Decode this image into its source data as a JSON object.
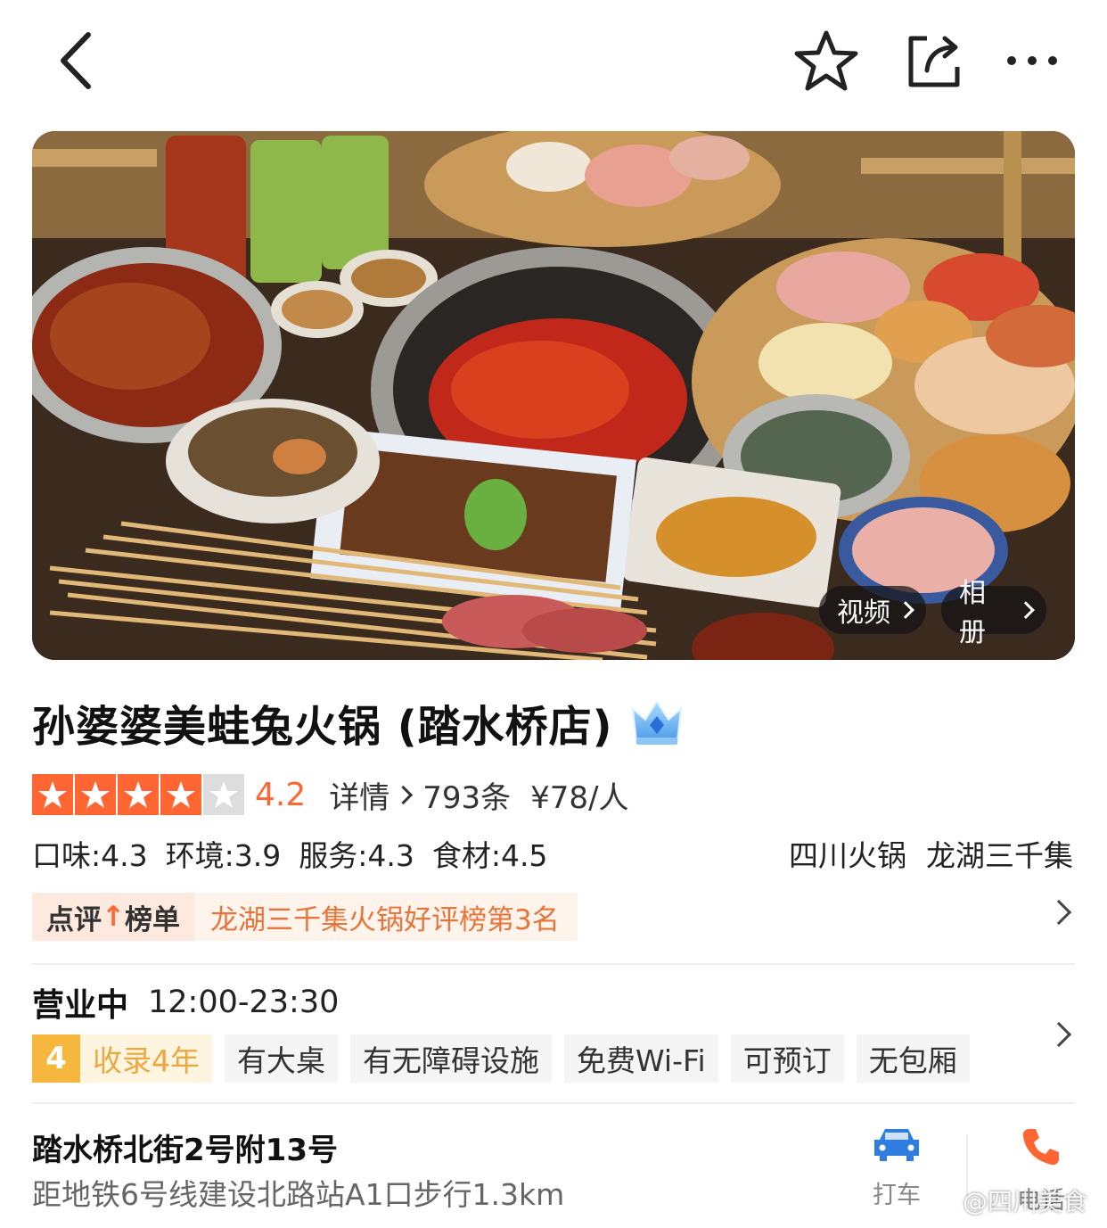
{
  "topbar": {
    "back_icon": "chevron-left-icon",
    "favorite_icon": "star-outline-icon",
    "share_icon": "share-icon",
    "more_icon": "more-dots-icon"
  },
  "hero": {
    "video_label": "视频",
    "album_label": "相册"
  },
  "shop": {
    "title": "孙婆婆美蛙兔火锅 (踏水桥店)",
    "title_badge_icon": "crown-icon"
  },
  "rating": {
    "stars": 4,
    "score": "4.2",
    "detail_label": "详情",
    "review_count": "793条",
    "price": "¥78/人"
  },
  "sub_scores": {
    "taste": "口味:4.3",
    "environment": "环境:3.9",
    "service": "服务:4.3",
    "ingredients": "食材:4.5"
  },
  "categories": {
    "cuisine": "四川火锅",
    "area": "龙湖三千集"
  },
  "ranking": {
    "badge_prefix": "点评",
    "badge_suffix": "榜单",
    "text": "龙湖三千集火锅好评榜第3名"
  },
  "hours": {
    "status": "营业中",
    "time": "12:00-23:30"
  },
  "facilities": {
    "years_num": "4",
    "years_text": "收录4年",
    "items": [
      "有大桌",
      "有无障碍设施",
      "免费Wi-Fi",
      "可预订",
      "无包厢"
    ]
  },
  "address": {
    "street": "踏水桥北街2号附13号",
    "distance": "距地铁6号线建设北路站A1口步行1.3km"
  },
  "actions": {
    "taxi_label": "打车",
    "phone_label": "电话"
  },
  "watermark": {
    "text": "@四川美食"
  },
  "colors": {
    "accent": "#ff6633",
    "rank_text": "#e8743a",
    "years_gold": "#f5b73e",
    "taxi_blue": "#2f7de1",
    "phone_orange": "#ff6633"
  }
}
